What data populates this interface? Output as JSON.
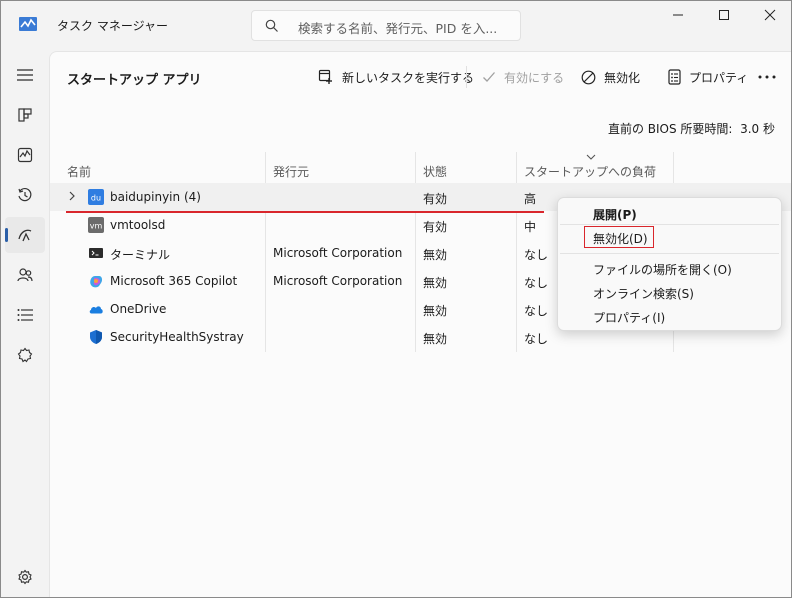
{
  "window": {
    "title": "タスク マネージャー",
    "search_placeholder": "検索する名前、発行元、PID を入..."
  },
  "sidebar": {
    "items": [
      "menu-icon",
      "processes-icon",
      "performance-icon",
      "app-history-icon",
      "startup-icon",
      "users-icon",
      "details-icon",
      "services-icon"
    ],
    "active": "startup-icon",
    "settings": "gear-icon"
  },
  "toolbar": {
    "page_title": "スタートアップ アプリ",
    "new_task": "新しいタスクを実行する",
    "enable": "有効にする",
    "disable": "無効化",
    "properties": "プロパティ"
  },
  "bios_label": "直前の BIOS 所要時間:",
  "bios_value": "3.0 秒",
  "columns": {
    "name": "名前",
    "publisher": "発行元",
    "status": "状態",
    "impact": "スタートアップへの負荷"
  },
  "rows": [
    {
      "name": "baidupinyin (4)",
      "publisher": "",
      "status": "有効",
      "impact": "高",
      "icon": "du-icon",
      "icon_label": "du"
    },
    {
      "name": "vmtoolsd",
      "publisher": "",
      "status": "有効",
      "impact": "中",
      "icon": "vm-icon",
      "icon_label": "vm"
    },
    {
      "name": "ターミナル",
      "publisher": "Microsoft Corporation",
      "status": "無効",
      "impact": "なし",
      "icon": "terminal-icon"
    },
    {
      "name": "Microsoft 365 Copilot",
      "publisher": "Microsoft Corporation",
      "status": "無効",
      "impact": "なし",
      "icon": "copilot-icon"
    },
    {
      "name": "OneDrive",
      "publisher": "",
      "status": "無効",
      "impact": "なし",
      "icon": "cloud-icon"
    },
    {
      "name": "SecurityHealthSystray",
      "publisher": "",
      "status": "無効",
      "impact": "なし",
      "icon": "shield-icon"
    }
  ],
  "context_menu": {
    "expand": "展開(P)",
    "disable": "無効化(D)",
    "open_location": "ファイルの場所を開く(O)",
    "search_online": "オンライン検索(S)",
    "properties": "プロパティ(I)"
  },
  "colors": {
    "accent": "#2b5fa8",
    "highlight": "#d9262c"
  }
}
